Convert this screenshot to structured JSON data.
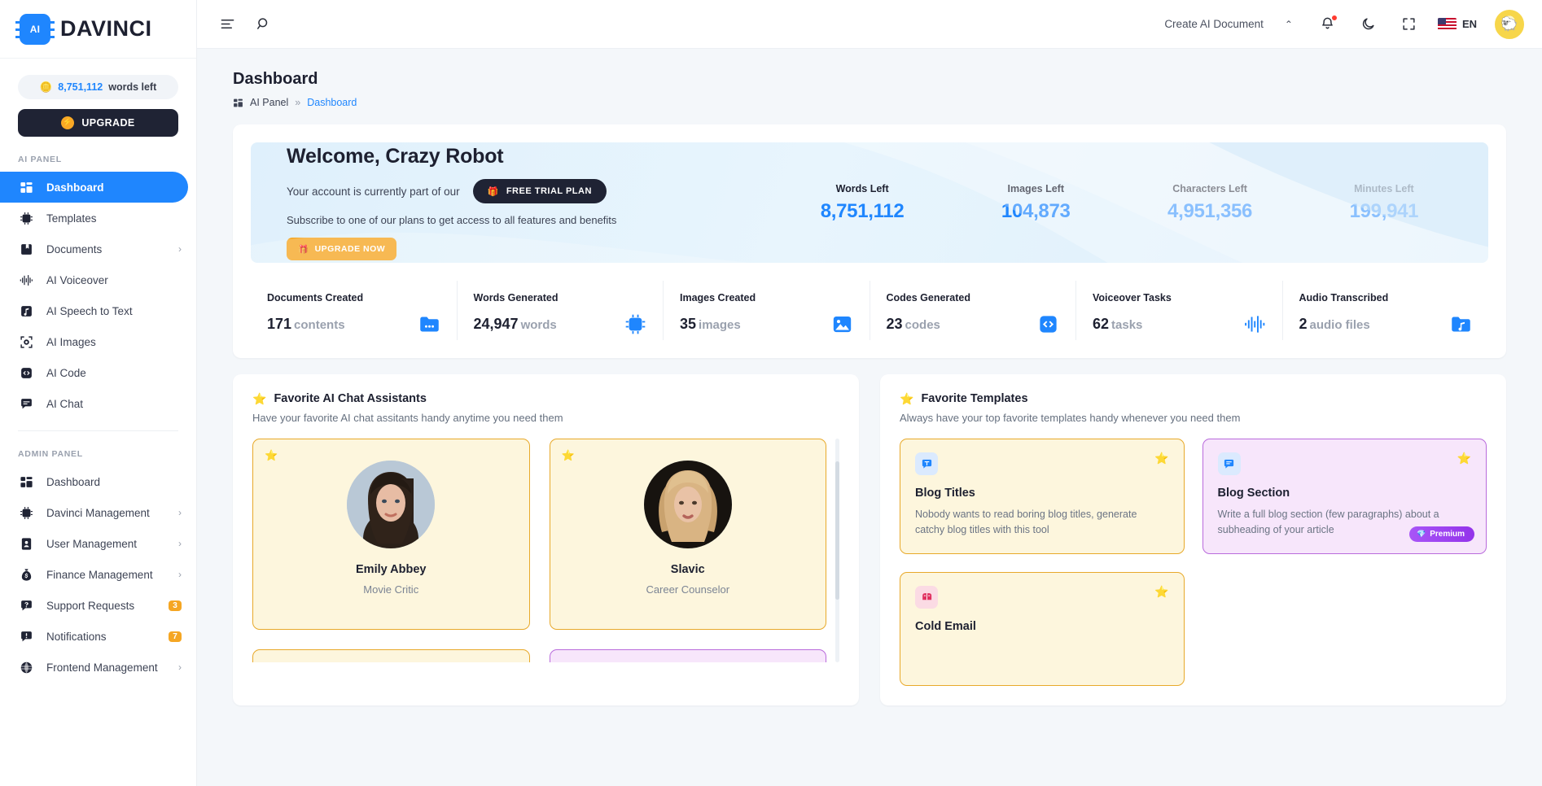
{
  "brand": {
    "logo_text": "AI",
    "name": "DAVINCI"
  },
  "sidebar": {
    "words_left": {
      "value": "8,751,112",
      "label": "words left",
      "icon": "coins-icon"
    },
    "upgrade_button": "UPGRADE",
    "sections": [
      {
        "label": "AI PANEL",
        "items": [
          {
            "label": "Dashboard",
            "icon": "dashboard-icon",
            "active": true,
            "chevron": "",
            "badge": ""
          },
          {
            "label": "Templates",
            "icon": "ai-chip-icon",
            "active": false,
            "chevron": "",
            "badge": ""
          },
          {
            "label": "Documents",
            "icon": "document-bookmark-icon",
            "active": false,
            "chevron": "›",
            "badge": ""
          },
          {
            "label": "AI Voiceover",
            "icon": "waveform-icon",
            "active": false,
            "chevron": "",
            "badge": ""
          },
          {
            "label": "AI Speech to Text",
            "icon": "music-note-icon",
            "active": false,
            "chevron": "",
            "badge": ""
          },
          {
            "label": "AI Images",
            "icon": "camera-icon",
            "active": false,
            "chevron": "",
            "badge": ""
          },
          {
            "label": "AI Code",
            "icon": "code-brackets-icon",
            "active": false,
            "chevron": "",
            "badge": ""
          },
          {
            "label": "AI Chat",
            "icon": "chat-bubble-icon",
            "active": false,
            "chevron": "",
            "badge": ""
          }
        ]
      },
      {
        "label": "ADMIN PANEL",
        "items": [
          {
            "label": "Dashboard",
            "icon": "dashboard-icon",
            "active": false,
            "chevron": "",
            "badge": ""
          },
          {
            "label": "Davinci Management",
            "icon": "ai-chip-icon",
            "active": false,
            "chevron": "›",
            "badge": ""
          },
          {
            "label": "User Management",
            "icon": "user-card-icon",
            "active": false,
            "chevron": "›",
            "badge": ""
          },
          {
            "label": "Finance Management",
            "icon": "money-bag-icon",
            "active": false,
            "chevron": "›",
            "badge": ""
          },
          {
            "label": "Support Requests",
            "icon": "question-bubble-icon",
            "active": false,
            "chevron": "",
            "badge": "3"
          },
          {
            "label": "Notifications",
            "icon": "alert-icon",
            "active": false,
            "chevron": "",
            "badge": "7"
          },
          {
            "label": "Frontend Management",
            "icon": "globe-icon",
            "active": false,
            "chevron": "›",
            "badge": ""
          }
        ]
      }
    ]
  },
  "topbar": {
    "menu_icon": "hamburger-icon",
    "search_icon": "search-icon",
    "create_document": "Create AI Document",
    "collapse_caret": "⌃",
    "notification_icon": "bell-icon",
    "theme_icon": "moon-icon",
    "fullscreen_icon": "fullscreen-icon",
    "language": "EN",
    "avatar_label": "user-avatar"
  },
  "page": {
    "title": "Dashboard",
    "breadcrumb": {
      "root": "AI Panel",
      "separator": "»",
      "current": "Dashboard"
    }
  },
  "banner": {
    "welcome": "Welcome, Crazy Robot",
    "plan_prefix": "Your account is currently part of our",
    "plan_chip": "FREE TRIAL PLAN",
    "plan_chip_icon": "gift-icon",
    "subtitle": "Subscribe to one of our plans to get access to all features and benefits",
    "upgrade_now": "UPGRADE NOW",
    "upgrade_now_icon": "gift-box-icon",
    "stats": [
      {
        "label": "Words Left",
        "value": "8,751,112"
      },
      {
        "label": "Images Left",
        "value": "104,873"
      },
      {
        "label": "Characters Left",
        "value": "4,951,356"
      },
      {
        "label": "Minutes Left",
        "value": "199,941"
      }
    ]
  },
  "stats_strip": [
    {
      "title": "Documents Created",
      "value": "171",
      "unit": "contents",
      "icon": "folder-icon"
    },
    {
      "title": "Words Generated",
      "value": "24,947",
      "unit": "words",
      "icon": "ai-chip-icon"
    },
    {
      "title": "Images Created",
      "value": "35",
      "unit": "images",
      "icon": "image-icon"
    },
    {
      "title": "Codes Generated",
      "value": "23",
      "unit": "codes",
      "icon": "code-brackets-icon"
    },
    {
      "title": "Voiceover Tasks",
      "value": "62",
      "unit": "tasks",
      "icon": "waveform-icon"
    },
    {
      "title": "Audio Transcribed",
      "value": "2",
      "unit": "audio files",
      "icon": "audio-folder-icon"
    }
  ],
  "favorite_assistants": {
    "title": "Favorite AI Chat Assistants",
    "subtitle": "Have your favorite AI chat assitants handy anytime you need them",
    "star_icon": "star-icon",
    "cards": [
      {
        "name": "Emily Abbey",
        "role": "Movie Critic",
        "accent": "#e8a92a",
        "avatar": "portrait-dark-hair"
      },
      {
        "name": "Slavic",
        "role": "Career Counselor",
        "accent": "#e8a92a",
        "avatar": "portrait-blonde-hair"
      }
    ]
  },
  "favorite_templates": {
    "title": "Favorite Templates",
    "subtitle": "Always have your top favorite templates handy whenever you need them",
    "star_icon": "star-icon",
    "cards": [
      {
        "name": "Blog Titles",
        "desc": "Nobody wants to read boring blog titles, generate catchy blog titles with this tool",
        "icon": "title-bubble-icon",
        "theme": "yellow",
        "premium": ""
      },
      {
        "name": "Blog Section",
        "desc": "Write a full blog section (few paragraphs) about a subheading of your article",
        "icon": "text-bubble-icon",
        "theme": "purple",
        "premium": "Premium"
      },
      {
        "name": "Cold Email",
        "desc": "",
        "icon": "mailbox-icon",
        "theme": "yellow",
        "premium": ""
      }
    ]
  },
  "colors": {
    "accent_blue": "#1f86fe",
    "accent_orange": "#f5a623",
    "dark": "#1f2334",
    "yellow_card_border": "#e8a92a",
    "purple_card_border": "#b96bdc"
  }
}
